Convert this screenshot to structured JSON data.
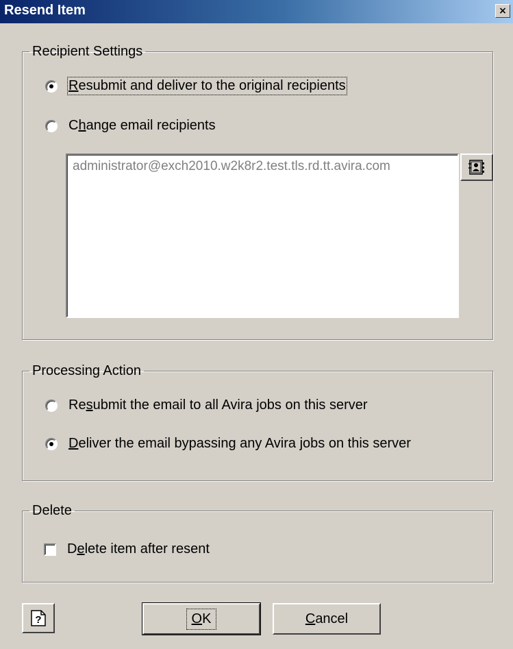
{
  "window": {
    "title": "Resend Item",
    "close_label": "×"
  },
  "recipient_settings": {
    "legend": "Recipient Settings",
    "option_original": {
      "accel": "R",
      "rest": "esubmit and deliver to the original recipients",
      "checked": true
    },
    "option_change": {
      "before": "C",
      "accel": "h",
      "rest": "ange email recipients",
      "checked": false
    },
    "recipients": [
      "administrator@exch2010.w2k8r2.test.tls.rd.tt.avira.com"
    ],
    "address_book_icon": "address-book-icon"
  },
  "processing_action": {
    "legend": "Processing Action",
    "option_resubmit": {
      "before": "Re",
      "accel": "s",
      "rest": "ubmit the email to all Avira jobs on this server",
      "checked": false
    },
    "option_deliver": {
      "before": "",
      "accel": "D",
      "rest": "eliver the email bypassing any Avira jobs on this server",
      "checked": true
    }
  },
  "delete": {
    "legend": "Delete",
    "checkbox": {
      "before": "D",
      "accel": "e",
      "rest": "lete item after resent",
      "checked": false
    }
  },
  "buttons": {
    "help_icon": "help-icon",
    "ok": {
      "accel": "O",
      "rest": "K"
    },
    "cancel": {
      "accel": "C",
      "rest": "ancel"
    }
  }
}
